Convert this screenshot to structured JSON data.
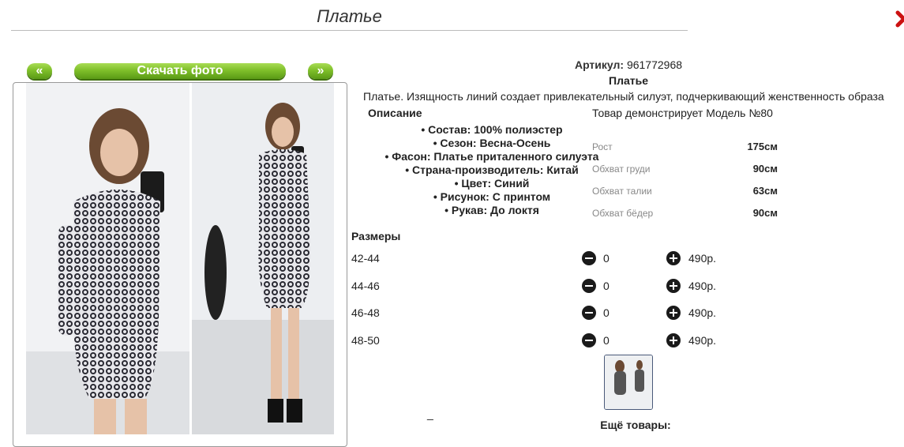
{
  "page": {
    "title": "Платье"
  },
  "gallery": {
    "prev_label": "«",
    "download_label": "Скачать фото",
    "next_label": "»"
  },
  "product": {
    "article_label": "Артикул:",
    "article_value": "961772968",
    "name": "Платье",
    "description": "Платье. Изящность линий создает привлекательный силуэт, подчеркивающий женственность образа",
    "description_heading": "Описание",
    "features": [
      "• Состав: 100% полиэстер",
      "• Сезон: Весна-Осень",
      "• Фасон: Платье приталенного силуэта",
      "• Страна-производитель: Китай",
      "• Цвет: Синий",
      "• Рисунок: С принтом",
      "• Рукав: До локтя"
    ],
    "model_text": "Товар демонстрирует Модель №80",
    "measurements": [
      {
        "label": "Рост",
        "value": "175см"
      },
      {
        "label": "Обхват груди",
        "value": "90см"
      },
      {
        "label": "Обхват талии",
        "value": "63см"
      },
      {
        "label": "Обхват бёдер",
        "value": "90см"
      }
    ]
  },
  "sizes": {
    "heading": "Размеры",
    "rows": [
      {
        "size": "42-44",
        "qty": "0",
        "price": "490р."
      },
      {
        "size": "44-46",
        "qty": "0",
        "price": "490р."
      },
      {
        "size": "46-48",
        "qty": "0",
        "price": "490р."
      },
      {
        "size": "48-50",
        "qty": "0",
        "price": "490р."
      }
    ]
  },
  "footer": {
    "dash": "_",
    "more_heading": "Ещё товары:"
  },
  "colors": {
    "accent_green": "#7fbf2a",
    "close_red": "#cc1111"
  }
}
